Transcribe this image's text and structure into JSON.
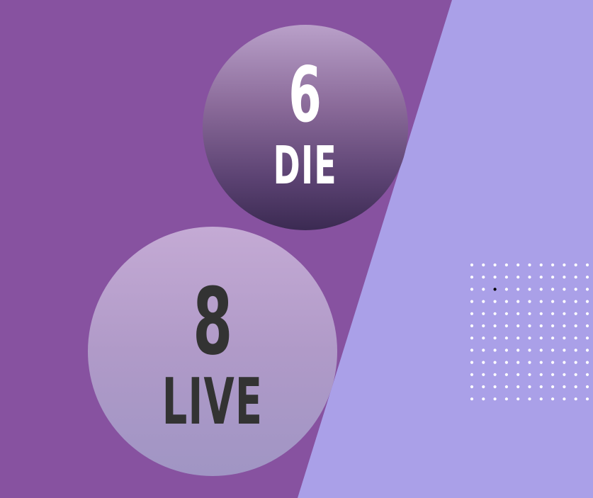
{
  "colors": {
    "background": "#8752a0",
    "diagonal_panel": "#aaa0e8",
    "top_text": "#ffffff",
    "bottom_text": "#333333",
    "dot": "#ffffff",
    "dot_highlight": "#000000"
  },
  "top_circle": {
    "number": "6",
    "word": "DIE"
  },
  "bottom_circle": {
    "number": "8",
    "word": "LIVE"
  },
  "dot_grid": {
    "rows": 12,
    "cols": 11,
    "highlight_row": 2,
    "highlight_col": 2
  }
}
